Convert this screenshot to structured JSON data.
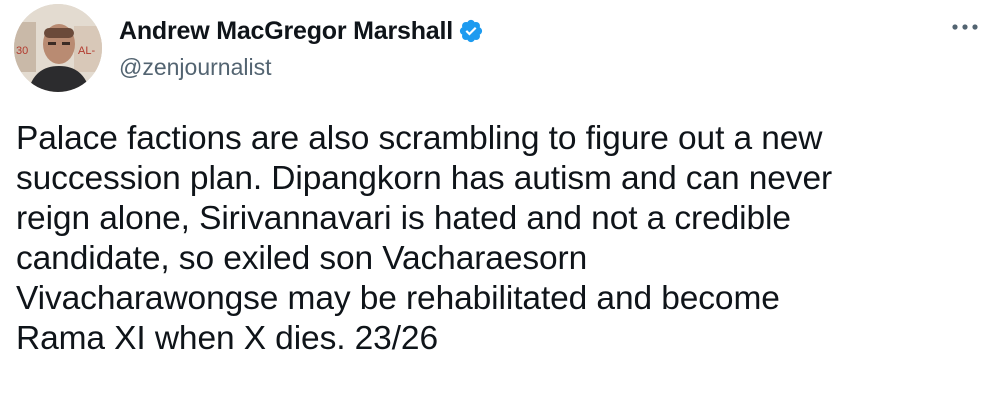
{
  "author": {
    "display_name": "Andrew MacGregor Marshall",
    "handle": "@zenjournalist",
    "verified": true,
    "avatar_icon": "profile-photo"
  },
  "actions": {
    "more_icon": "ellipsis-icon"
  },
  "tweet": {
    "text": "Palace factions are also scrambling to figure out a new\nsuccession plan. Dipangkorn has autism and can never\nreign alone, Sirivannavari is hated and not a credible\ncandidate, so exiled son Vacharaesorn\nVivacharawongse may be rehabilitated and become\nRama XI when X dies. 23/26"
  },
  "colors": {
    "verified_badge": "#1d9bf0",
    "secondary_text": "#536471",
    "primary_text": "#0f1419"
  }
}
